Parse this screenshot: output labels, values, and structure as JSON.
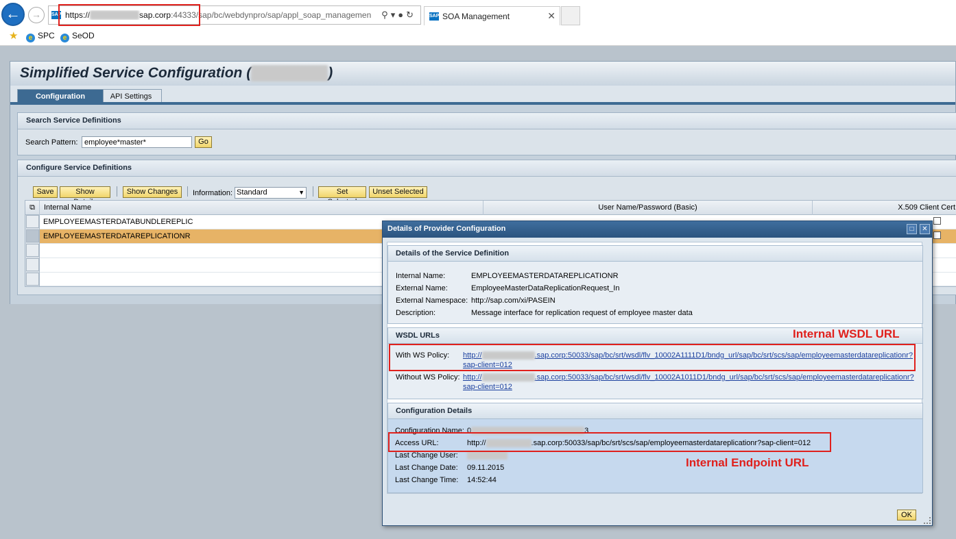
{
  "browser": {
    "url_prefix": "https://",
    "url_host_suffix": "sap.corp",
    "url_port": ":44333",
    "url_path": "/sap/bc/webdynpro/sap/appl_soap_managemen",
    "site_icon": "SAP",
    "tab_title": "SOA Management",
    "favorites": [
      "SPC",
      "SeOD"
    ]
  },
  "page": {
    "title_prefix": "Simplified Service Configuration (",
    "title_suffix": ")",
    "tabs": [
      "Configuration",
      "API Settings"
    ],
    "search_group": {
      "header": "Search Service Definitions",
      "label": "Search Pattern:",
      "value": "employee*master*",
      "go": "Go"
    },
    "config_group": {
      "header": "Configure Service Definitions",
      "buttons": {
        "save": "Save",
        "show_details": "Show Details",
        "show_changes": "Show Changes",
        "set_selected": "Set Selected",
        "unset_selected": "Unset Selected"
      },
      "info_label": "Information:",
      "info_value": "Standard",
      "columns": [
        "Internal Name",
        "User Name/Password (Basic)",
        "X.509 Client Cert"
      ],
      "rows": [
        "EMPLOYEEMASTERDATABUNDLEREPLIC",
        "EMPLOYEEMASTERDATAREPLICATIONR"
      ]
    }
  },
  "dialog": {
    "title": "Details of Provider Configuration",
    "service_definition": {
      "header": "Details of the Service Definition",
      "internal_name_label": "Internal Name:",
      "internal_name": "EMPLOYEEMASTERDATAREPLICATIONR",
      "external_name_label": "External Name:",
      "external_name": "EmployeeMasterDataReplicationRequest_In",
      "namespace_label": "External Namespace:",
      "namespace": "http://sap.com/xi/PASEIN",
      "description_label": "Description:",
      "description": "Message interface for replication request of employee master data"
    },
    "wsdl": {
      "header": "WSDL URLs",
      "with_policy_label": "With WS Policy:",
      "with_policy_prefix": "http://",
      "with_policy_url": ".sap.corp:50033/sap/bc/srt/wsdl/flv_10002A1111D1/bndg_url/sap/bc/srt/scs/sap/employeemasterdatareplicationr?",
      "with_policy_url2": "sap-client=012",
      "without_policy_label": "Without WS Policy:",
      "without_policy_prefix": "http://",
      "without_policy_url": ".sap.corp:50033/sap/bc/srt/wsdl/flv_10002A1011D1/bndg_url/sap/bc/srt/scs/sap/employeemasterdatareplicationr?",
      "without_policy_url2": "sap-client=012"
    },
    "config": {
      "header": "Configuration Details",
      "name_label": "Configuration Name:",
      "name_prefix": "0",
      "name_suffix": "3",
      "access_label": "Access URL:",
      "access_prefix": "http://",
      "access_url": ".sap.corp:50033/sap/bc/srt/scs/sap/employeemasterdatareplicationr?sap-client=012",
      "user_label": "Last Change User:",
      "date_label": "Last Change Date:",
      "date": "09.11.2015",
      "time_label": "Last Change Time:",
      "time": "14:52:44"
    },
    "ok": "OK"
  },
  "annotations": {
    "wsdl": "Internal WSDL URL",
    "endpoint": "Internal Endpoint URL"
  },
  "colors": {
    "highlight_red": "#e0201c",
    "sap_blue": "#3d6a92",
    "selected_row": "#e7b366",
    "button_yellow": "#f1d56b"
  },
  "icons": [
    "back-arrow-icon",
    "forward-arrow-icon",
    "search-icon",
    "dropdown-icon",
    "lock-icon",
    "refresh-icon",
    "close-icon",
    "favorites-star-icon",
    "ie-page-icon",
    "maximize-icon",
    "select-all-icon"
  ]
}
